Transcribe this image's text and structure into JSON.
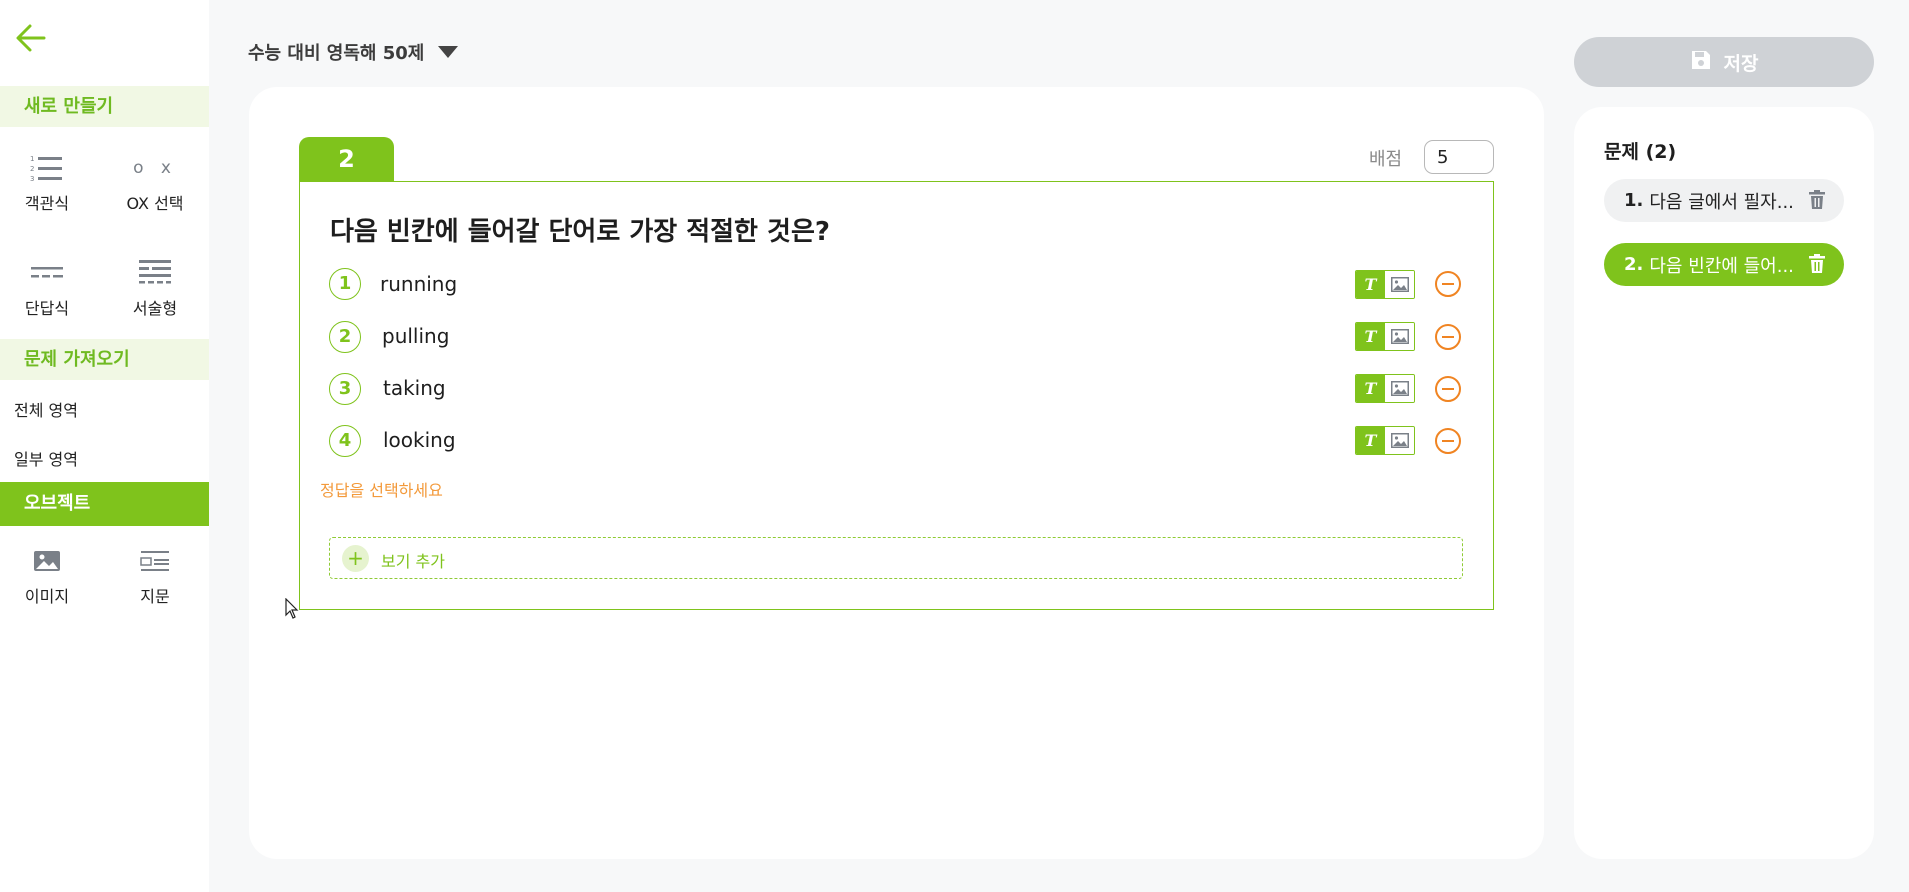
{
  "sidebar": {
    "sections": {
      "create": "새로 만들기",
      "import": "문제 가져오기",
      "object": "오브젝트"
    },
    "tools": {
      "multiple_choice": "객관식",
      "ox_select": "OX 선택",
      "short_answer": "단답식",
      "essay": "서술형",
      "image": "이미지",
      "passage": "지문"
    },
    "ox_icon_text": "o x",
    "import_links": {
      "full_area": "전체 영역",
      "partial_area": "일부 영역"
    }
  },
  "header": {
    "exam_title": "수능 대비 영독해 50제"
  },
  "editor": {
    "question_number": "2",
    "score_label": "배점",
    "score_value": "5",
    "question_text": "다음 빈칸에 들어갈 단어로 가장 적절한 것은?",
    "options": [
      {
        "num": "1",
        "text": "running"
      },
      {
        "num": "2",
        "text": "pulling"
      },
      {
        "num": "3",
        "text": "taking"
      },
      {
        "num": "4",
        "text": "looking"
      }
    ],
    "text_mode_glyph": "T",
    "answer_hint": "정답을 선택하세요",
    "add_option_plus": "+",
    "add_option_label": "보기 추가"
  },
  "right_panel": {
    "save_label": "저장",
    "list_title": "문제 (2)",
    "questions": [
      {
        "num": "1.",
        "text": "다음 글에서 필자..."
      },
      {
        "num": "2.",
        "text": "다음 빈칸에 들어..."
      }
    ]
  },
  "colors": {
    "accent": "#7fc31c",
    "accent_light": "#f1f8e4",
    "warning": "#f08422",
    "disabled": "#cfd2d6"
  }
}
